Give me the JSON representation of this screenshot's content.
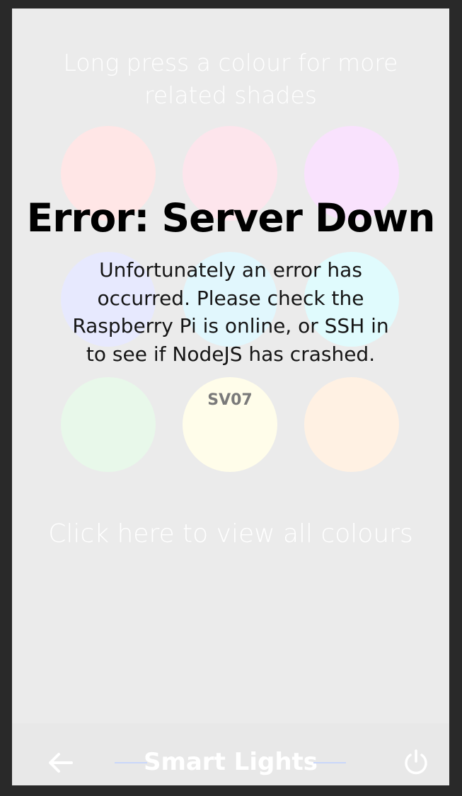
{
  "page": {
    "hint": "Long press a colour for more\nrelated shades",
    "view_all_link": "Click here to view all colours"
  },
  "swatches": [
    {
      "color": "#ffe6e6",
      "label": ""
    },
    {
      "color": "#fde5ec",
      "label": ""
    },
    {
      "color": "#f9e2fd",
      "label": ""
    },
    {
      "color": "#e7e9fe",
      "label": ""
    },
    {
      "color": "#e1f7fd",
      "label": ""
    },
    {
      "color": "#e0fbfd",
      "label": ""
    },
    {
      "color": "#e8f8ea",
      "label": ""
    },
    {
      "color": "#fffdea",
      "label": "SV07"
    },
    {
      "color": "#fff1e3",
      "label": ""
    }
  ],
  "error": {
    "title": "Error: Server Down",
    "message": "Unfortunately an error has occurred. Please check the Raspberry Pi is online, or SSH in to see if NodeJS has crashed."
  },
  "bottom_bar": {
    "title": "Smart Lights",
    "back_icon": "arrow-left-icon",
    "power_icon": "power-icon"
  },
  "colors": {
    "frame": "#292929",
    "screen_background": "#ebebeb",
    "title_line": "#c9d7fa"
  }
}
